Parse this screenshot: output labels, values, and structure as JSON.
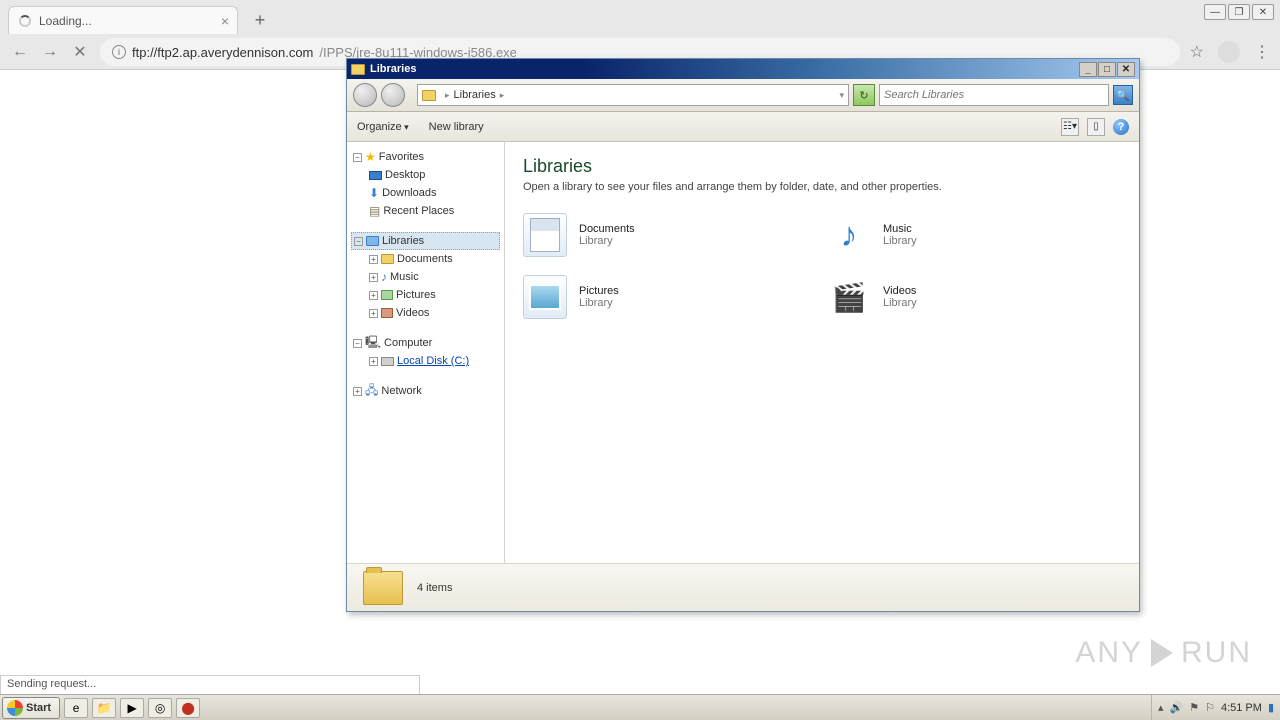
{
  "browser": {
    "tab_title": "Loading...",
    "url_host": "ftp://ftp2.ap.averydennison.com",
    "url_path": "/IPPS/jre-8u111-windows-i586.exe",
    "status_text": "Sending request..."
  },
  "explorer": {
    "title": "Libraries",
    "breadcrumb": "Libraries",
    "search_placeholder": "Search Libraries",
    "toolbar": {
      "organize": "Organize",
      "new_library": "New library"
    },
    "tree": {
      "favorites": {
        "label": "Favorites",
        "items": [
          "Desktop",
          "Downloads",
          "Recent Places"
        ]
      },
      "libraries": {
        "label": "Libraries",
        "items": [
          "Documents",
          "Music",
          "Pictures",
          "Videos"
        ]
      },
      "computer": {
        "label": "Computer",
        "items": [
          "Local Disk (C:)"
        ]
      },
      "network": {
        "label": "Network"
      }
    },
    "content": {
      "heading": "Libraries",
      "subtext": "Open a library to see your files and arrange them by folder, date, and other properties.",
      "items": [
        {
          "name": "Documents",
          "kind": "Library"
        },
        {
          "name": "Music",
          "kind": "Library"
        },
        {
          "name": "Pictures",
          "kind": "Library"
        },
        {
          "name": "Videos",
          "kind": "Library"
        }
      ]
    },
    "status": "4 items"
  },
  "taskbar": {
    "start": "Start",
    "time": "4:51 PM"
  },
  "watermark": {
    "a": "ANY",
    "b": "RUN"
  }
}
